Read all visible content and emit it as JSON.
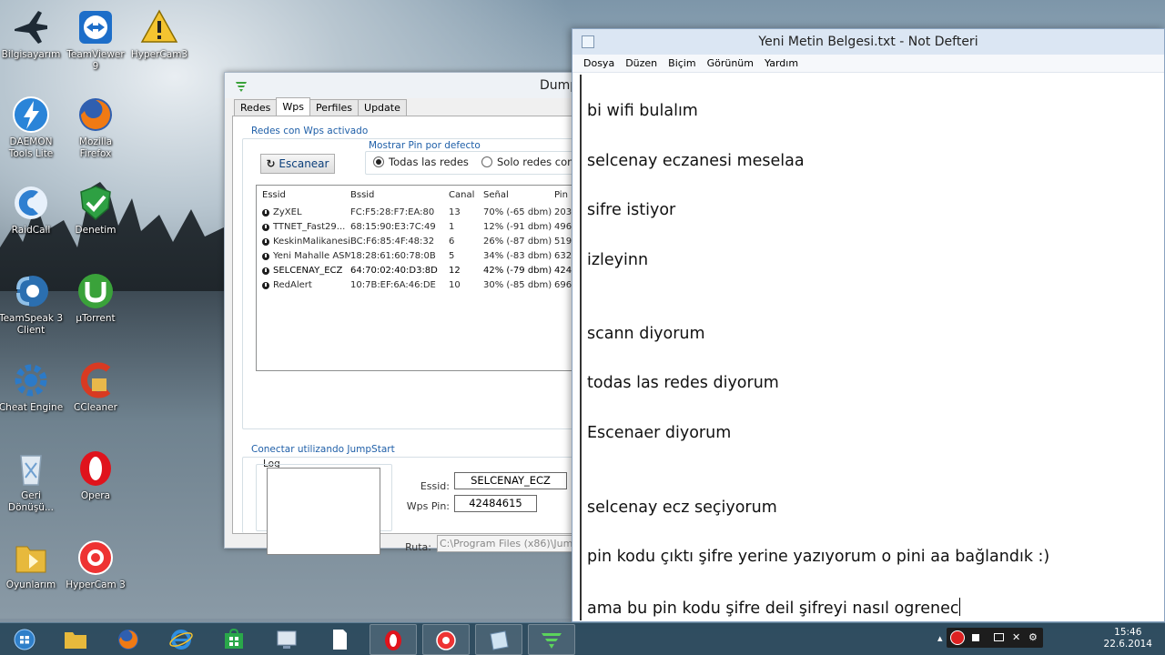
{
  "desktop": {
    "icons": [
      {
        "label": "Bilgisayarım",
        "icon": "computer-icon"
      },
      {
        "label": "TeamViewer 9",
        "icon": "teamviewer-icon"
      },
      {
        "label": "HyperCam3",
        "icon": "hypercam-warning-icon"
      },
      {
        "label": "DAEMON Tools Lite",
        "icon": "daemon-tools-icon"
      },
      {
        "label": "Mozilla Firefox",
        "icon": "firefox-icon"
      },
      {
        "label": "RaidCall",
        "icon": "raidcall-icon"
      },
      {
        "label": "Denetim",
        "icon": "shield-check-icon"
      },
      {
        "label": "TeamSpeak 3 Client",
        "icon": "teamspeak-icon"
      },
      {
        "label": "µTorrent",
        "icon": "utorrent-icon"
      },
      {
        "label": "Cheat Engine",
        "icon": "cheat-engine-icon"
      },
      {
        "label": "CCleaner",
        "icon": "ccleaner-icon"
      },
      {
        "label": "Geri Dönüşü...",
        "icon": "recycle-bin-icon"
      },
      {
        "label": "Opera",
        "icon": "opera-icon"
      },
      {
        "label": "Oyunlarım",
        "icon": "games-folder-icon"
      },
      {
        "label": "HyperCam 3",
        "icon": "hypercam-icon"
      }
    ]
  },
  "dumpper": {
    "title": "Dump",
    "tabs": [
      "Redes",
      "Wps",
      "Perfiles",
      "Update"
    ],
    "active_tab": "Wps",
    "wps_group_title": "Redes con Wps activado",
    "scan_button": "Escanear",
    "pin_group_title": "Mostrar Pin por defecto",
    "radio_all": "Todas las redes",
    "radio_only": "Solo redes conc",
    "columns": [
      "Essid",
      "Bssid",
      "Canal",
      "Señal",
      "Pin"
    ],
    "networks": [
      {
        "essid": "ZyXEL",
        "bssid": "FC:F5:28:F7:EA:80",
        "canal": "13",
        "senal": "70% (-65 dbm)",
        "pin": "203"
      },
      {
        "essid": "TTNET_Fast29...",
        "bssid": "68:15:90:E3:7C:49",
        "canal": "1",
        "senal": "12% (-91 dbm)",
        "pin": "496"
      },
      {
        "essid": "KeskinMalikanesi",
        "bssid": "BC:F6:85:4F:48:32",
        "canal": "6",
        "senal": "26% (-87 dbm)",
        "pin": "519"
      },
      {
        "essid": "Yeni Mahalle ASM",
        "bssid": "18:28:61:60:78:0B",
        "canal": "5",
        "senal": "34% (-83 dbm)",
        "pin": "632"
      },
      {
        "essid": "SELCENAY_ECZ",
        "bssid": "64:70:02:40:D3:8D",
        "canal": "12",
        "senal": "42% (-79 dbm)",
        "pin": "424"
      },
      {
        "essid": "RedAlert",
        "bssid": "10:7B:EF:6A:46:DE",
        "canal": "10",
        "senal": "30% (-85 dbm)",
        "pin": "696"
      }
    ],
    "jumpstart_group_title": "Conectar utilizando JumpStart",
    "log_label": "Log",
    "essid_label": "Essid:",
    "essid_value": "SELCENAY_ECZ",
    "wpspin_label": "Wps Pin:",
    "wpspin_value": "42484615",
    "ruta_label": "Ruta:",
    "ruta_value": "C:\\Program Files (x86)\\Jump"
  },
  "notepad": {
    "title": "Yeni Metin Belgesi.txt - Not Defteri",
    "menus": [
      "Dosya",
      "Düzen",
      "Biçim",
      "Görünüm",
      "Yardım"
    ],
    "lines": [
      "bi wifi bulalım",
      "selcenay eczanesi meselaa",
      "sifre istiyor",
      "izleyinn",
      "scann diyorum",
      "todas las redes diyorum",
      "Escenaer diyorum",
      "selcenay ecz seçiyorum",
      "pin kodu çıktı şifre yerine yazıyorum o pini aa bağlandık :)",
      "ama bu pin kodu şifre deil şifreyi nasıl ogrenec"
    ]
  },
  "taskbar": {
    "items": [
      "start-icon",
      "file-explorer-icon",
      "firefox-icon",
      "internet-explorer-icon",
      "store-icon",
      "control-panel-icon",
      "blank-document-icon",
      "opera-icon",
      "hypercam-icon",
      "notepad-icon",
      "dumpper-wifi-icon"
    ],
    "time": "15:46",
    "date": "22.6.2014"
  }
}
